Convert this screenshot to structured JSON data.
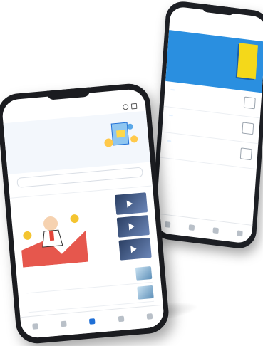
{
  "back": {
    "brand": "",
    "title": "",
    "hero_lines": [
      "",
      "",
      ""
    ],
    "items": [
      {
        "text": "",
        "chip": ""
      },
      {
        "text": "",
        "chip": ""
      },
      {
        "text": "",
        "chip": ""
      }
    ]
  },
  "front": {
    "brand": "",
    "banner_line1": "",
    "banner_line2_blue": "",
    "banner_line2_rest": "",
    "search": "",
    "tabs": [
      "",
      "",
      "",
      "",
      ""
    ],
    "list": [
      "",
      ""
    ],
    "tabbar": [
      "",
      "",
      "",
      "",
      ""
    ]
  },
  "colors": {
    "accent": "#1f6fd6",
    "hero": "#2a8fe0",
    "book": "#f4d81a"
  }
}
